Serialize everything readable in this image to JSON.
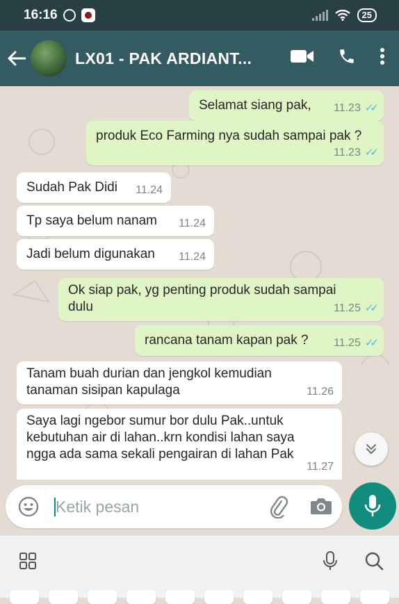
{
  "status_bar": {
    "time": "16:16",
    "battery": "25"
  },
  "header": {
    "title": "LX01 - PAK ARDIANT..."
  },
  "messages": [
    {
      "direction": "out",
      "text": "Selamat siang pak,",
      "time": "11.23",
      "read": true
    },
    {
      "direction": "out",
      "text": "produk Eco Farming nya sudah sampai pak ?",
      "time": "11.23",
      "read": true
    },
    {
      "direction": "in",
      "text": "Sudah Pak Didi",
      "time": "11.24"
    },
    {
      "direction": "in",
      "text": "Tp saya belum nanam",
      "time": "11.24"
    },
    {
      "direction": "in",
      "text": "Jadi belum digunakan",
      "time": "11.24"
    },
    {
      "direction": "out",
      "text_lines": [
        "Ok siap pak, yg penting produk sudah sampai",
        "dulu"
      ],
      "time": "11.25",
      "read": true
    },
    {
      "direction": "out",
      "text": "rancana tanam kapan pak ?",
      "time": "11.25",
      "read": true
    },
    {
      "direction": "in",
      "text_lines": [
        "Tanam buah durian dan jengkol kemudian",
        "tanaman sisipan kapulaga"
      ],
      "time": "11.26"
    },
    {
      "direction": "in",
      "text_lines": [
        "Saya lagi ngebor sumur bor dulu Pak..untuk",
        "kebutuhan air di lahan..krn kondisi lahan saya",
        "ngga ada sama sekali pengairan di lahan Pak"
      ],
      "time": "11.27"
    }
  ],
  "composer": {
    "placeholder": "Ketik pesan"
  },
  "icons": {
    "back": "arrow-left-icon",
    "video": "video-call-icon",
    "phone": "voice-call-icon",
    "menu": "more-vert-icon",
    "emoji": "emoji-icon",
    "attach": "paperclip-icon",
    "camera": "camera-icon",
    "mic": "microphone-icon",
    "scroll": "chevron-double-down-icon",
    "grid": "apps-grid-icon",
    "search": "search-icon"
  },
  "colors": {
    "header": "#345b62",
    "status_bar": "#283f43",
    "outgoing_bubble": "#e0f5c6",
    "incoming_bubble": "#ffffff",
    "read_ticks": "#4fb6ec",
    "accent": "#128c7e"
  }
}
